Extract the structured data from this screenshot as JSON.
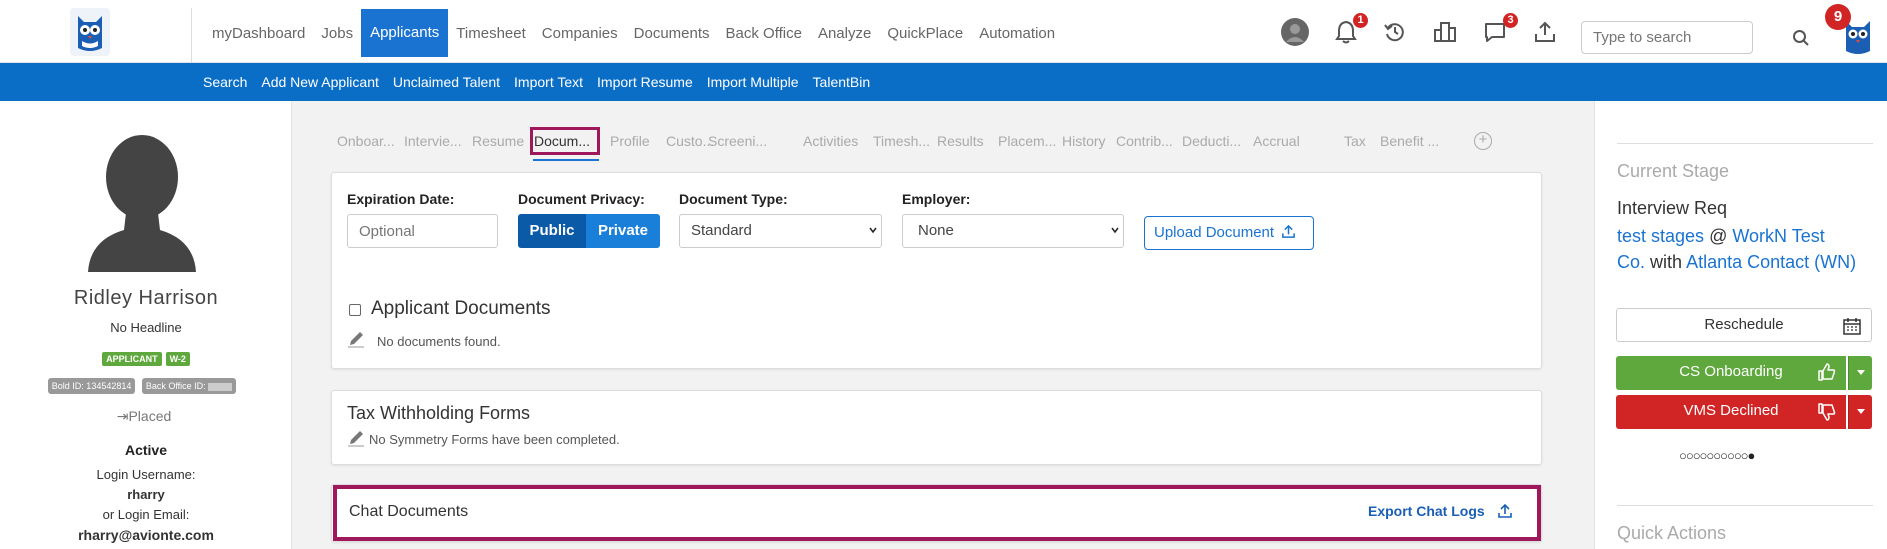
{
  "nav": {
    "items": [
      "myDashboard",
      "Jobs",
      "Applicants",
      "Timesheet",
      "Companies",
      "Documents",
      "Back Office",
      "Analyze",
      "QuickPlace",
      "Automation"
    ],
    "active": "Applicants",
    "notifications_count": "1",
    "messages_count": "3",
    "user_count": "9",
    "search_placeholder": "Type to search"
  },
  "subnav": {
    "items": [
      "Search",
      "Add New Applicant",
      "Unclaimed Talent",
      "Import Text",
      "Import Resume",
      "Import Multiple",
      "TalentBin"
    ]
  },
  "profile": {
    "name": "Ridley Harrison",
    "headline": "No Headline",
    "tags": [
      "APPLICANT",
      "W-2"
    ],
    "bold_id": "Bold ID: 134542814",
    "back_office_id": "Back Office ID:",
    "placed": "Placed",
    "status": "Active",
    "login_username_label": "Login Username:",
    "login_username": "rharry",
    "login_email_label": "or Login Email:",
    "login_email": "rharry@avionte.com"
  },
  "tabs": {
    "items": [
      "Onboar...",
      "Intervie...",
      "Resume",
      "Docum...",
      "Profile",
      "Custo...",
      "Screeni...",
      "Activities",
      "Timesh...",
      "Results",
      "Placem...",
      "History",
      "Contrib...",
      "Deducti...",
      "Accrual",
      "Tax",
      "Benefit ..."
    ],
    "active": "Docum..."
  },
  "upload_form": {
    "expiration_label": "Expiration Date:",
    "expiration_placeholder": "Optional",
    "privacy_label": "Document Privacy:",
    "public_label": "Public",
    "private_label": "Private",
    "type_label": "Document Type:",
    "type_value": "Standard",
    "employer_label": "Employer:",
    "employer_value": "None",
    "upload_button": "Upload Document",
    "applicant_docs_title": "Applicant Documents",
    "no_docs": "No documents found."
  },
  "tax_forms": {
    "title": "Tax Withholding Forms",
    "empty": "No Symmetry Forms have been completed."
  },
  "chat_docs": {
    "title": "Chat Documents",
    "export_label": "Export Chat Logs"
  },
  "stage": {
    "heading": "Current Stage",
    "name": "Interview Req",
    "link1": "test stages",
    "at": "@",
    "link2": "WorkN Test Co.",
    "with": "with",
    "link3": "Atlanta Contact (WN)",
    "reschedule": "Reschedule",
    "accept": "CS Onboarding",
    "decline": "VMS Declined",
    "progress": "○○○○○○○○○○●"
  },
  "quick_actions": {
    "heading": "Quick Actions"
  },
  "colors": {
    "primary": "#1a73d0",
    "green": "#5fa83d",
    "red": "#d12424",
    "highlight": "#a0185c"
  }
}
